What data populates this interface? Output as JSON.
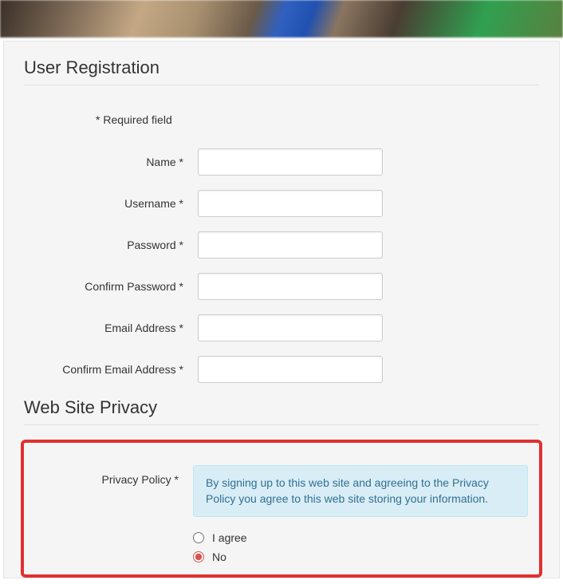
{
  "heading": "User Registration",
  "required_note": "* Required field",
  "fields": {
    "name": {
      "label": "Name *",
      "value": ""
    },
    "username": {
      "label": "Username *",
      "value": ""
    },
    "password": {
      "label": "Password *",
      "value": ""
    },
    "confirm_password": {
      "label": "Confirm Password *",
      "value": ""
    },
    "email": {
      "label": "Email Address *",
      "value": ""
    },
    "confirm_email": {
      "label": "Confirm Email Address *",
      "value": ""
    }
  },
  "privacy_section": {
    "heading": "Web Site Privacy",
    "label": "Privacy Policy *",
    "info_text": "By signing up to this web site and agreeing to the Privacy Policy you agree to this web site storing your information.",
    "options": {
      "agree": {
        "label": "I agree",
        "checked": false
      },
      "no": {
        "label": "No",
        "checked": true
      }
    }
  }
}
